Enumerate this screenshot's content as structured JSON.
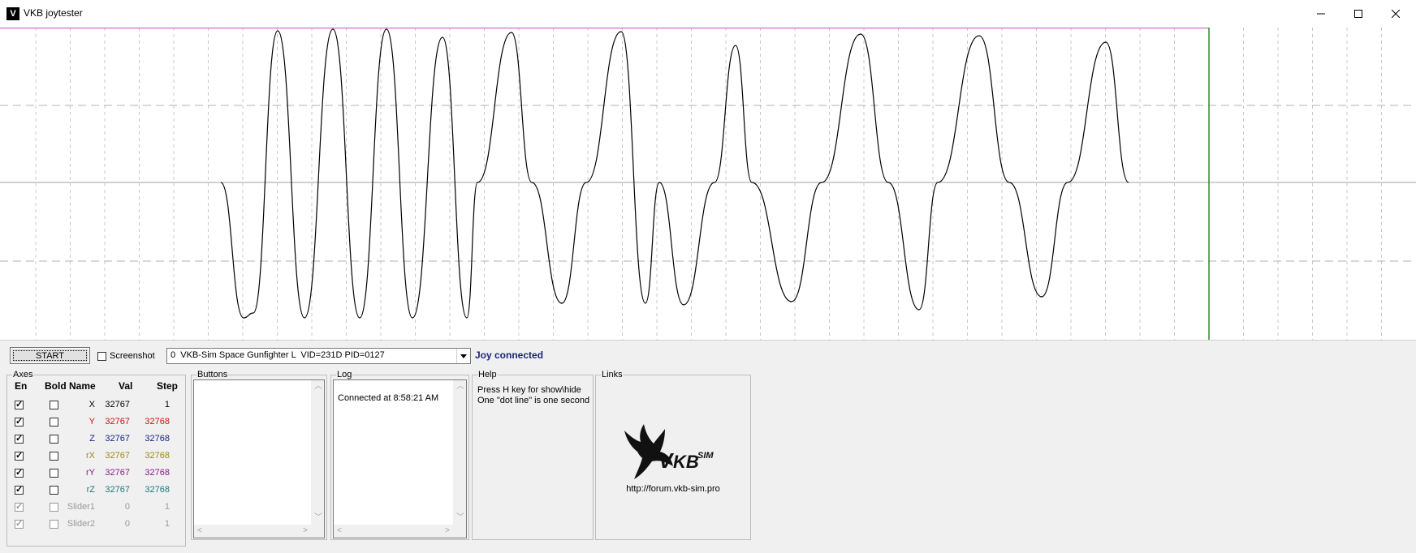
{
  "window": {
    "title": "VKB joytester",
    "icon": "vkb-app-icon"
  },
  "plot": {
    "gridlines": "dashed",
    "cursor_color": "#2e8b2e",
    "top_line_color": "#d56ad5",
    "trace_color": "#000000"
  },
  "toolbar": {
    "start_label": "START",
    "screenshot_label": "Screenshot",
    "screenshot_checked": false,
    "device_value": "0  VKB-Sim Space Gunfighter L  VID=231D PID=0127",
    "status": "Joy connected"
  },
  "axes": {
    "title": "Axes",
    "headers": {
      "en": "En",
      "bold": "Bold",
      "name": "Name",
      "val": "Val",
      "step": "Step"
    },
    "rows": [
      {
        "name": "X",
        "val": "32767",
        "step": "1",
        "en": true,
        "bold": false,
        "color": "#000000"
      },
      {
        "name": "Y",
        "val": "32767",
        "step": "32768",
        "en": true,
        "bold": false,
        "color": "#d01010"
      },
      {
        "name": "Z",
        "val": "32767",
        "step": "32768",
        "en": true,
        "bold": false,
        "color": "#1a237e"
      },
      {
        "name": "rX",
        "val": "32767",
        "step": "32768",
        "en": true,
        "bold": false,
        "color": "#9a8a1a"
      },
      {
        "name": "rY",
        "val": "32767",
        "step": "32768",
        "en": true,
        "bold": false,
        "color": "#8a1a8a"
      },
      {
        "name": "rZ",
        "val": "32767",
        "step": "32768",
        "en": true,
        "bold": false,
        "color": "#1a7a7a"
      },
      {
        "name": "Slider1",
        "val": "0",
        "step": "1",
        "en": true,
        "bold": false,
        "color": "#9a9a9a"
      },
      {
        "name": "Slider2",
        "val": "0",
        "step": "1",
        "en": true,
        "bold": false,
        "color": "#9a9a9a"
      }
    ]
  },
  "buttons": {
    "title": "Buttons"
  },
  "log": {
    "title": "Log",
    "entries": [
      "Connected at 8:58:21 AM"
    ]
  },
  "help": {
    "title": "Help",
    "lines": [
      "Press H key for show\\hide",
      "One \"dot line\" is one second"
    ]
  },
  "links": {
    "title": "Links",
    "url": "http://forum.vkb-sim.pro",
    "logo_text": "KB",
    "logo_sup": "SIM",
    "logo_v": "V"
  }
}
